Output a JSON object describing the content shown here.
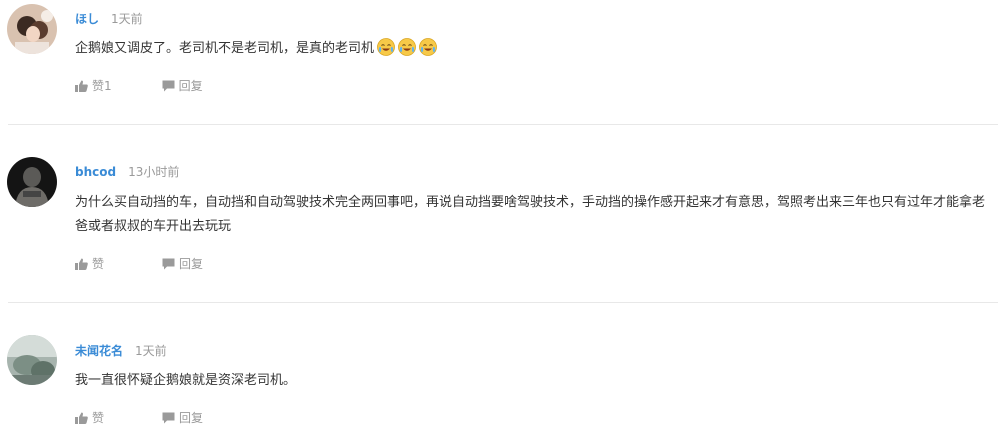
{
  "colors": {
    "username": "#3a8bd6",
    "meta_text": "#9a9a9a",
    "body_text": "#333333",
    "divider": "#e8e8e8"
  },
  "comments": [
    {
      "username": "ほし",
      "time": "1天前",
      "text": "企鹅娘又调皮了。老司机不是老司机，是真的老司机",
      "emojis": [
        "crying-laughing-emoji",
        "crying-laughing-emoji",
        "crying-laughing-emoji"
      ],
      "like_label": "赞1",
      "reply_label": "回复"
    },
    {
      "username": "bhcod",
      "time": "13小时前",
      "text": "为什么买自动挡的车，自动挡和自动驾驶技术完全两回事吧，再说自动挡要啥驾驶技术，手动挡的操作感开起来才有意思，驾照考出来三年也只有过年才能拿老爸或者叔叔的车开出去玩玩",
      "like_label": "赞",
      "reply_label": "回复"
    },
    {
      "username": "未闻花名",
      "time": "1天前",
      "text": "我一直很怀疑企鹅娘就是资深老司机。",
      "like_label": "赞",
      "reply_label": "回复"
    }
  ]
}
